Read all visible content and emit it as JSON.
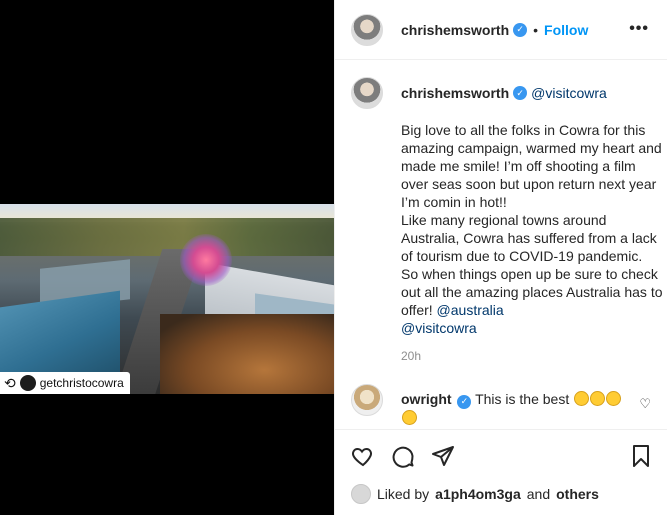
{
  "repost": {
    "username": "getchristocowra",
    "icon": "repost-icon"
  },
  "header": {
    "username": "chrishemsworth",
    "verified": true,
    "separator": "•",
    "follow_label": "Follow",
    "more_label": "•••"
  },
  "caption": {
    "username": "chrishemsworth",
    "mention": "@visitcowra",
    "text": "Big love to all the folks in Cowra for this amazing campaign, warmed my heart and made me smile! I’m off shooting a film over seas soon but upon return next year I’m comin in hot!!\nLike many regional towns around Australia, Cowra has suffered from a lack of tourism due to COVID-19 pandemic. So when things open up be sure to check out all the amazing places Australia has to offer!",
    "mention_australia": "@australia",
    "mention_visitcowra": "@visitcowra",
    "time": "20h"
  },
  "reply": {
    "username": "owright",
    "text": "This is the best"
  },
  "actions": {
    "icons": [
      "heart-icon",
      "comment-icon",
      "share-icon",
      "bookmark-icon"
    ]
  },
  "likes": {
    "prefix": "Liked by",
    "user": "a1ph4om3ga",
    "conjunction": "and",
    "others": "others"
  },
  "colors": {
    "accent": "#0095f6",
    "verified": "#3897f0",
    "link": "#00376b",
    "muted": "#8e8e8e"
  }
}
